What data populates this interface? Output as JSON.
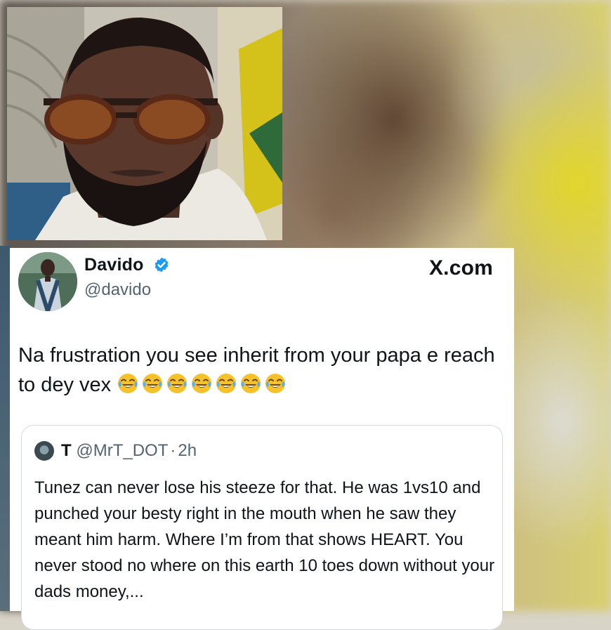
{
  "site": {
    "brand": "X.com"
  },
  "tweet": {
    "display_name": "Davido",
    "verified": true,
    "handle": "@davido",
    "text": "Na frustration  you see inherit from your papa e reach to dey vex",
    "emoji_count": 7,
    "emoji_name": "tears-of-joy-emoji"
  },
  "quoted_tweet": {
    "display_name": "T",
    "handle": "@MrT_DOT",
    "separator": "·",
    "time": "2h",
    "text": "Tunez can never lose his steeze for that. He was 1vs10 and punched your besty right in the mouth when he saw they meant him harm. Where I’m from that shows HEART. You never stood no where on this earth 10 toes down without your dads money,..."
  },
  "colors": {
    "text_primary": "#0f1419",
    "text_secondary": "#536471",
    "verified_blue": "#1d9bf0",
    "card_border": "#d3dbe0"
  }
}
